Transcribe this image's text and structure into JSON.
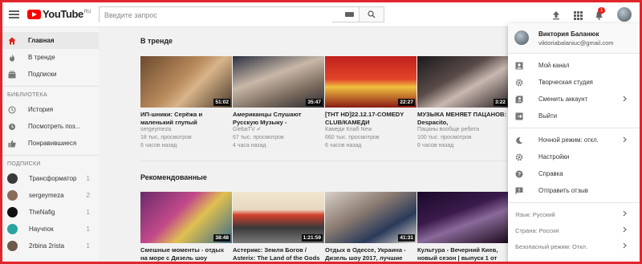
{
  "header": {
    "logo_text": "YouTube",
    "logo_region": "RU",
    "search_placeholder": "Введите запрос",
    "notification_count": "1"
  },
  "sidebar": {
    "nav": [
      {
        "label": "Главная",
        "icon": "home-icon",
        "active": true
      },
      {
        "label": "В тренде",
        "icon": "flame-icon",
        "active": false
      },
      {
        "label": "Подписки",
        "icon": "subscriptions-icon",
        "active": false
      }
    ],
    "library_heading": "БИБЛИОТЕКА",
    "library": [
      {
        "label": "История",
        "icon": "history-icon"
      },
      {
        "label": "Посмотреть поз...",
        "icon": "clock-icon"
      },
      {
        "label": "Понравившиеся",
        "icon": "thumbs-up-icon"
      }
    ],
    "subs_heading": "ПОДПИСКИ",
    "subscriptions": [
      {
        "label": "Трансформатор",
        "count": "1",
        "color": "#3a3a3a"
      },
      {
        "label": "sergeymeza",
        "count": "2",
        "color": "#8a6a58"
      },
      {
        "label": "TheNafig",
        "count": "1",
        "color": "#111111"
      },
      {
        "label": "Научпок",
        "count": "1",
        "color": "#2aa3a0"
      },
      {
        "label": "2rbina 2rista",
        "count": "1",
        "color": "#6d5a4a"
      }
    ]
  },
  "main": {
    "trending_title": "В тренде",
    "trending": [
      {
        "title": "ИП-шники: Серёжа и маленький глупый",
        "channel": "sergeymeza",
        "views": "18 тыс. просмотров",
        "age": "6 часов назад",
        "duration": "51:02"
      },
      {
        "title": "Американцы Слушают Русскую Музыку -",
        "channel": "GlebaTV",
        "views": "67 тыс. просмотров",
        "age": "4 часа назад",
        "duration": "35:47"
      },
      {
        "title": "[ТНТ HD]22.12.17-COMEDY CLUB/КАМЕДИ",
        "channel": "Камеди Клаб New",
        "views": "660 тыс. просмотров",
        "age": "6 часов назад",
        "duration": "22:27"
      },
      {
        "title": "МУЗЫКА МЕНЯЕТ ПАЦАНОВ: Despacito,",
        "channel": "Пацаны вообще ребята",
        "views": "100 тыс. просмотров",
        "age": "6 часов назад",
        "duration": "3:22"
      }
    ],
    "recommended_title": "Рекомендованные",
    "recommended": [
      {
        "title": "Смешные моменты - отдых на море с Дизель шоу",
        "duration": "38:48"
      },
      {
        "title": "Астерикс: Земля Богов / Asterix: The Land of the Gods",
        "duration": "1:21:59"
      },
      {
        "title": "Отдых в Одессе, Украина - Дизель шоу 2017, лучшие",
        "duration": "41:31"
      },
      {
        "title": "Культура - Вечерний Киев, новый сезон | выпуск 1 от",
        "duration": ""
      }
    ]
  },
  "menu": {
    "name": "Виктория Баланюк",
    "email": "viktoriabalaniuc@gmail.com",
    "items": [
      {
        "label": "Мой канал",
        "icon": "account-icon",
        "chevron": false
      },
      {
        "label": "Творческая студия",
        "icon": "gear-icon",
        "chevron": false
      },
      {
        "label": "Сменить аккаунт",
        "icon": "switch-account-icon",
        "chevron": true
      },
      {
        "label": "Выйти",
        "icon": "sign-out-icon",
        "chevron": false
      }
    ],
    "items2": [
      {
        "label": "Ночной режим: откл.",
        "icon": "moon-icon",
        "chevron": true
      },
      {
        "label": "Настройки",
        "icon": "gear-icon",
        "chevron": false
      },
      {
        "label": "Справка",
        "icon": "help-icon",
        "chevron": false
      },
      {
        "label": "Отправить отзыв",
        "icon": "feedback-icon",
        "chevron": false
      }
    ],
    "options": [
      {
        "label": "Язык: Русский"
      },
      {
        "label": "Страна: Россия"
      },
      {
        "label": "Безопасный режим: Откл."
      }
    ]
  }
}
